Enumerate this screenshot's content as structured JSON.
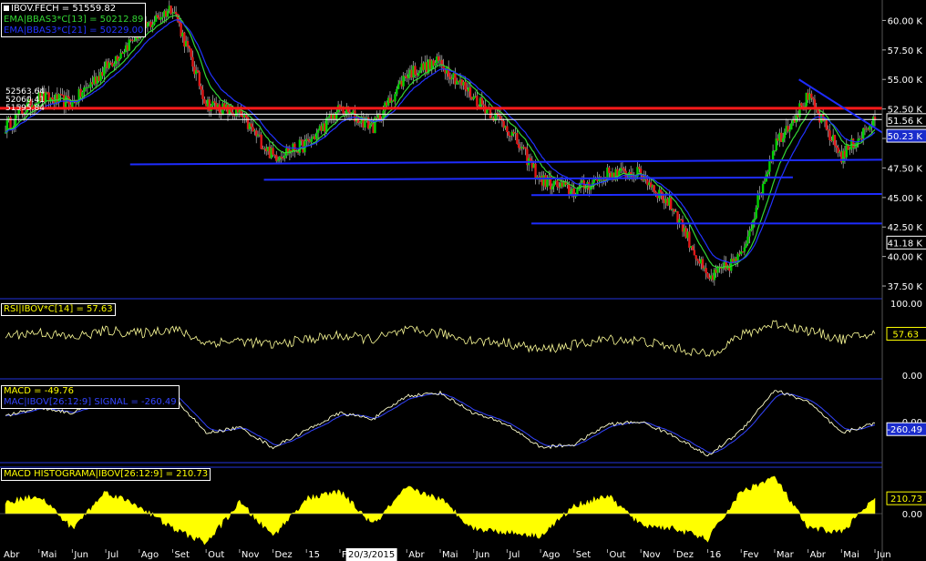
{
  "colors": {
    "background": "#000000",
    "price_up": "#00d000",
    "price_down": "#e01818",
    "ema13": "#33d633",
    "ema21": "#2233ff",
    "support_lines": "#1e2cff",
    "resistance_line": "#ff1a1a",
    "rsi": "#ffff99",
    "macd": "#ffffcc",
    "macd_signal": "#3344ff",
    "histogram": "#ffff00",
    "axis_text": "#ffffff",
    "panel_border": "#2233dd"
  },
  "legends": {
    "price": {
      "close": "IBOV.FECH = 51559.82",
      "ema13": "EMA|BBAS3*C[13] = 50212.89",
      "ema21": "EMA|BBAS3*C[21] = 50229.00"
    },
    "rsi": "RSI|IBOV*C[14] = 57.63",
    "macd": {
      "macd": "MACD = -49.76",
      "signal": "MAC|IBOV[26:12:9] SIGNAL = -260.49"
    },
    "histogram": "MACD HISTOGRAMA|IBOV[26:12:9] = 210.73"
  },
  "left_labels": [
    "52563.64",
    "52060.41",
    "51595.84"
  ],
  "axes": {
    "price_ticks": [
      "60.00 K",
      "57.50 K",
      "55.00 K",
      "52.50 K",
      "50.00 K",
      "47.50 K",
      "45.00 K",
      "42.50 K",
      "40.00 K",
      "37.50 K"
    ],
    "price_flags": [
      {
        "value": 51.56,
        "text": "51.56 K",
        "style": "white"
      },
      {
        "value": 50.23,
        "text": "50.23 K",
        "style": "blue"
      },
      {
        "value": 41.18,
        "text": "41.18 K",
        "style": "white"
      }
    ],
    "rsi_ticks": [
      "100.00",
      "0.00"
    ],
    "rsi_flag": "57.63",
    "macd_ticks": [
      "0.00"
    ],
    "macd_flag": "-260.49",
    "hist_ticks": [
      "0.00"
    ],
    "hist_flag": "210.73",
    "months": [
      "Mai",
      "Jun",
      "Jul",
      "Ago",
      "Set",
      "Out",
      "Nov",
      "Dez",
      "15",
      "Fev",
      "",
      "Abr",
      "Mai",
      "Jun",
      "Jul",
      "Ago",
      "Set",
      "Out",
      "Nov",
      "Dez",
      "16",
      "Fev",
      "Mar",
      "Abr",
      "Mai",
      "Jun"
    ],
    "first_label": "Abr",
    "cursor_date": "20/3/2015"
  },
  "chart_data": [
    {
      "type": "line",
      "title": "IBOV.FECH",
      "unit": "K points",
      "x_range": [
        "2014-04",
        "2016-06"
      ],
      "ylim": [
        36.5,
        61.5
      ],
      "series": [
        {
          "name": "IBOV.FECH",
          "x": [
            "2014-04",
            "2014-05",
            "2014-06",
            "2014-07",
            "2014-08",
            "2014-09",
            "2014-10",
            "2014-11",
            "2014-12",
            "2015-01",
            "2015-02",
            "2015-03",
            "2015-04",
            "2015-05",
            "2015-06",
            "2015-07",
            "2015-08",
            "2015-09",
            "2015-10",
            "2015-11",
            "2015-12",
            "2016-01",
            "2016-02",
            "2016-03",
            "2016-04",
            "2016-05",
            "2016-06"
          ],
          "values": [
            51.0,
            53.5,
            53.0,
            56.0,
            59.0,
            61.2,
            53.0,
            52.0,
            48.5,
            49.5,
            52.5,
            51.0,
            55.5,
            56.5,
            53.5,
            51.0,
            46.5,
            45.5,
            47.0,
            47.0,
            44.0,
            38.0,
            40.0,
            49.5,
            53.5,
            48.5,
            51.56
          ]
        },
        {
          "name": "EMA|BBAS3*C[13]",
          "last": 50212.89
        },
        {
          "name": "EMA|BBAS3*C[21]",
          "last": 50229.0
        }
      ],
      "horizontal_lines": [
        {
          "value": 52.56,
          "color": "#ff1a1a"
        },
        {
          "value": 52.06,
          "color": "#ffffff"
        },
        {
          "value": 51.6,
          "color": "#ffffff"
        }
      ],
      "trend_lines": [
        {
          "from": [
            "2014-08",
            47.8
          ],
          "to": [
            "2016-06",
            48.2
          ]
        },
        {
          "from": [
            "2014-12",
            46.5
          ],
          "to": [
            "2016-03",
            46.7
          ]
        },
        {
          "from": [
            "2015-08",
            45.2
          ],
          "to": [
            "2016-06",
            45.3
          ]
        },
        {
          "from": [
            "2015-08",
            42.8
          ],
          "to": [
            "2016-06",
            42.8
          ]
        },
        {
          "from": [
            "2016-04",
            55.0
          ],
          "to": [
            "2016-06",
            50.5
          ]
        }
      ]
    },
    {
      "type": "line",
      "title": "RSI|IBOV*C[14]",
      "ylim": [
        0,
        100
      ],
      "series": [
        {
          "name": "RSI|IBOV*C[14]",
          "values": [
            55,
            60,
            52,
            62,
            58,
            65,
            45,
            48,
            42,
            50,
            55,
            50,
            62,
            58,
            48,
            45,
            35,
            42,
            50,
            48,
            38,
            28,
            55,
            72,
            62,
            50,
            57.63
          ]
        }
      ]
    },
    {
      "type": "line",
      "title": "MACD",
      "series": [
        {
          "name": "MACD",
          "last": -49.76,
          "values": [
            200,
            500,
            300,
            800,
            1000,
            900,
            -400,
            -200,
            -900,
            -300,
            300,
            100,
            900,
            1000,
            300,
            -100,
            -900,
            -800,
            -100,
            0,
            -500,
            -1200,
            -300,
            1100,
            700,
            -400,
            -49.76
          ]
        },
        {
          "name": "MAC|IBOV[26:12:9] SIGNAL",
          "last": -260.49
        }
      ]
    },
    {
      "type": "bar",
      "title": "MACD HISTOGRAMA|IBOV[26:12:9]",
      "series": [
        {
          "name": "MACD HISTOGRAMA|IBOV[26:12:9]",
          "last": 210.73,
          "values": [
            150,
            250,
            -200,
            300,
            100,
            -200,
            -400,
            150,
            -300,
            200,
            300,
            -150,
            350,
            200,
            -200,
            -250,
            -300,
            100,
            250,
            -150,
            -200,
            -350,
            300,
            500,
            -200,
            -250,
            210.73
          ]
        }
      ]
    }
  ]
}
